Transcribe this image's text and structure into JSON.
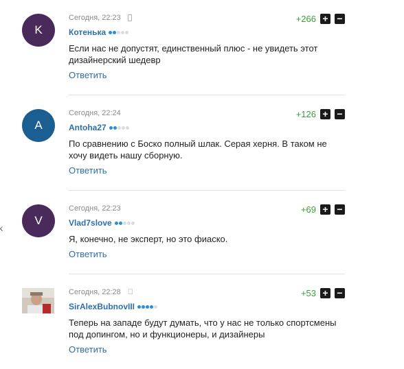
{
  "edge_mark": "k",
  "reply_label": "Ответить",
  "vote": {
    "up_symbol": "+",
    "down_symbol": "−"
  },
  "comments": [
    {
      "avatar_letter": "K",
      "avatar_color": "#4a2a5a",
      "timestamp": "Сегодня, 22:23",
      "device_icon": "phone-icon",
      "author": "Котенька",
      "rating_dots": 2,
      "text": "Если нас не допустят, единственный плюс - не увидеть этот дизайнерский шедевр",
      "score": "+266"
    },
    {
      "avatar_letter": "A",
      "avatar_color": "#1b5f92",
      "timestamp": "Сегодня, 22:24",
      "device_icon": "",
      "author": "Antoha27",
      "rating_dots": 2,
      "text": "По сравнению с Боско полный шлак. Серая херня. В таком не хочу видеть нашу сборную.",
      "score": "+126"
    },
    {
      "avatar_letter": "V",
      "avatar_color": "#4a2a5a",
      "timestamp": "Сегодня, 22:23",
      "device_icon": "",
      "author": "Vlad7slove",
      "rating_dots": 2,
      "text": "Я, конечно, не эксперт, но это фиаско.",
      "score": "+69"
    },
    {
      "avatar_letter": "",
      "avatar_color": "#d6d0c6",
      "timestamp": "Сегодня, 22:28",
      "device_icon": "apple-icon",
      "author": "SirAlexBubnovIII",
      "rating_dots": 4,
      "text": "Теперь на западе будут думать, что у нас не только спортсмены под допингом, но и функционеры, и дизайнеры",
      "score": "+53"
    }
  ]
}
